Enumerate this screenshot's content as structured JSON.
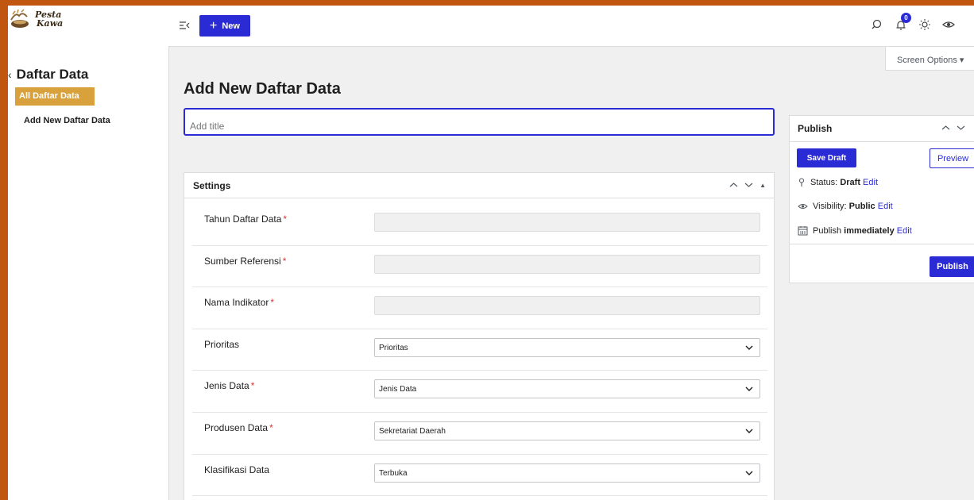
{
  "brand": {
    "line1": "Pesta",
    "line2": "Kawa"
  },
  "sidebar": {
    "section_title": "Daftar Data",
    "items": [
      {
        "label": "All Daftar Data",
        "active": true
      },
      {
        "label": "Add New Daftar Data",
        "active": false
      }
    ]
  },
  "topbar": {
    "new_label": "New",
    "notification_count": "0",
    "icons": [
      "search-icon",
      "bell-icon",
      "sun-icon",
      "eye-icon"
    ]
  },
  "screen_options": {
    "label": "Screen Options"
  },
  "page": {
    "title": "Add New Daftar Data",
    "title_placeholder": "Add title"
  },
  "settings": {
    "title": "Settings",
    "fields": [
      {
        "label": "Tahun Daftar Data",
        "required": "*",
        "type": "text",
        "value": ""
      },
      {
        "label": "Sumber Referensi",
        "required": "*",
        "type": "text",
        "value": ""
      },
      {
        "label": "Nama Indikator",
        "required": "*",
        "type": "text",
        "value": ""
      },
      {
        "label": "Prioritas",
        "required": "",
        "type": "select",
        "value": "Prioritas"
      },
      {
        "label": "Jenis Data",
        "required": "*",
        "type": "select",
        "value": "Jenis Data"
      },
      {
        "label": "Produsen Data",
        "required": "*",
        "type": "select",
        "value": "Sekretariat Daerah"
      },
      {
        "label": "Klasifikasi Data",
        "required": "",
        "type": "select",
        "value": "Terbuka"
      }
    ]
  },
  "publish": {
    "title": "Publish",
    "save_draft": "Save Draft",
    "preview": "Preview",
    "status_label": "Status:",
    "status_value": "Draft",
    "visibility_label": "Visibility:",
    "visibility_value": "Public",
    "publish_label": "Publish",
    "publish_value": "immediately",
    "edit_label": "Edit",
    "publish_button": "Publish"
  },
  "colors": {
    "accent": "#2b2bd6",
    "frame": "#c0560f",
    "active_menu": "#d9a13c",
    "required": "#d63638"
  }
}
